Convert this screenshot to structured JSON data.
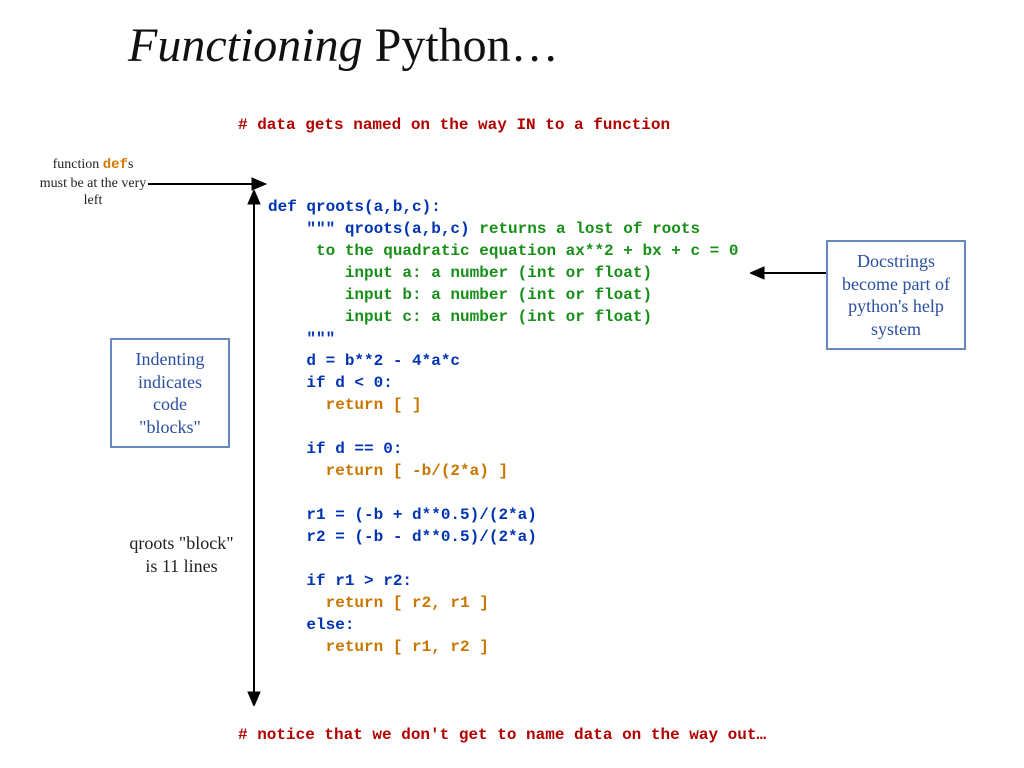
{
  "title_a": "Functioning",
  "title_b": " Python…",
  "top_comment": "# data gets named on the way IN to a function",
  "bottom_comment": "# notice that we don't get to name data on the way out…",
  "side_note": {
    "pre": "function ",
    "kw": "def",
    "post": "s must be at the very left"
  },
  "indent_box": "Indenting indicates code \"blocks\"",
  "docstring_box": "Docstrings become part of python's help system",
  "qroots_note": "qroots \"block\" is 11 lines",
  "code": {
    "l01": "def qroots(a,b,c):",
    "l02a": "    \"\"\" qroots(a,b,c) ",
    "l02b": "returns a lost of roots",
    "l03": "     to the quadratic equation ax**2 + bx + c = 0",
    "l04": "        input a: a number (int or float)",
    "l05": "        input b: a number (int or float)",
    "l06": "        input c: a number (int or float)",
    "l07": "    \"\"\"",
    "l08": "    d = b**2 - 4*a*c",
    "l09": "    if d < 0:",
    "l10": "      return [ ]",
    "l11": "",
    "l12": "    if d == 0:",
    "l13": "      return [ -b/(2*a) ]",
    "l14": "",
    "l15": "    r1 = (-b + d**0.5)/(2*a)",
    "l16": "    r2 = (-b - d**0.5)/(2*a)",
    "l17": "",
    "l18": "    if r1 > r2:",
    "l19": "      return [ r2, r1 ]",
    "l20": "    else:",
    "l21": "      return [ r1, r2 ]"
  }
}
